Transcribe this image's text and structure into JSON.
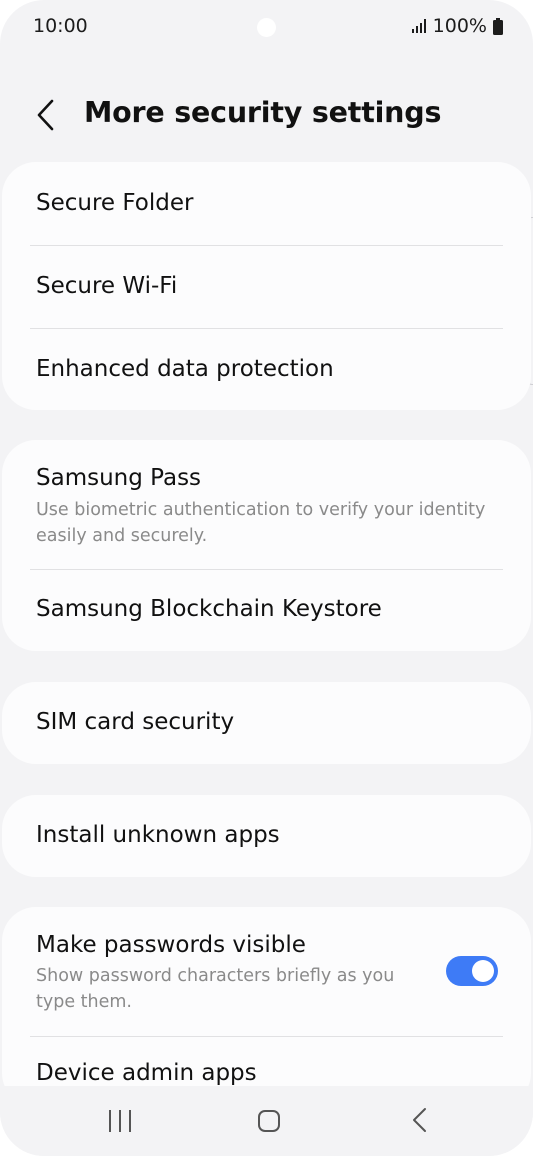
{
  "status_bar": {
    "time": "10:00",
    "battery": "100%",
    "icons": [
      "signal-icon",
      "battery-icon"
    ]
  },
  "header": {
    "title": "More security settings",
    "back_icon": "chevron-left-icon"
  },
  "groups": [
    {
      "items": [
        {
          "title": "Secure Folder"
        },
        {
          "title": "Secure Wi-Fi"
        },
        {
          "title": "Enhanced data protection"
        }
      ]
    },
    {
      "items": [
        {
          "title": "Samsung Pass",
          "subtitle": "Use biometric authentication to verify your identity easily and securely."
        },
        {
          "title": "Samsung Blockchain Keystore"
        }
      ]
    },
    {
      "items": [
        {
          "title": "SIM card security"
        }
      ]
    },
    {
      "items": [
        {
          "title": "Install unknown apps"
        }
      ]
    },
    {
      "items": [
        {
          "title": "Make passwords visible",
          "subtitle": "Show password characters briefly as you type them.",
          "toggle": true
        },
        {
          "title": "Device admin apps"
        }
      ]
    }
  ],
  "nav_bar": {
    "icons": [
      "recents-icon",
      "home-icon",
      "back-icon"
    ]
  },
  "colors": {
    "background": "#f3f3f5",
    "card": "#fcfcfd",
    "toggle_on": "#3e7bf6",
    "subtitle": "#8a8a8a"
  }
}
